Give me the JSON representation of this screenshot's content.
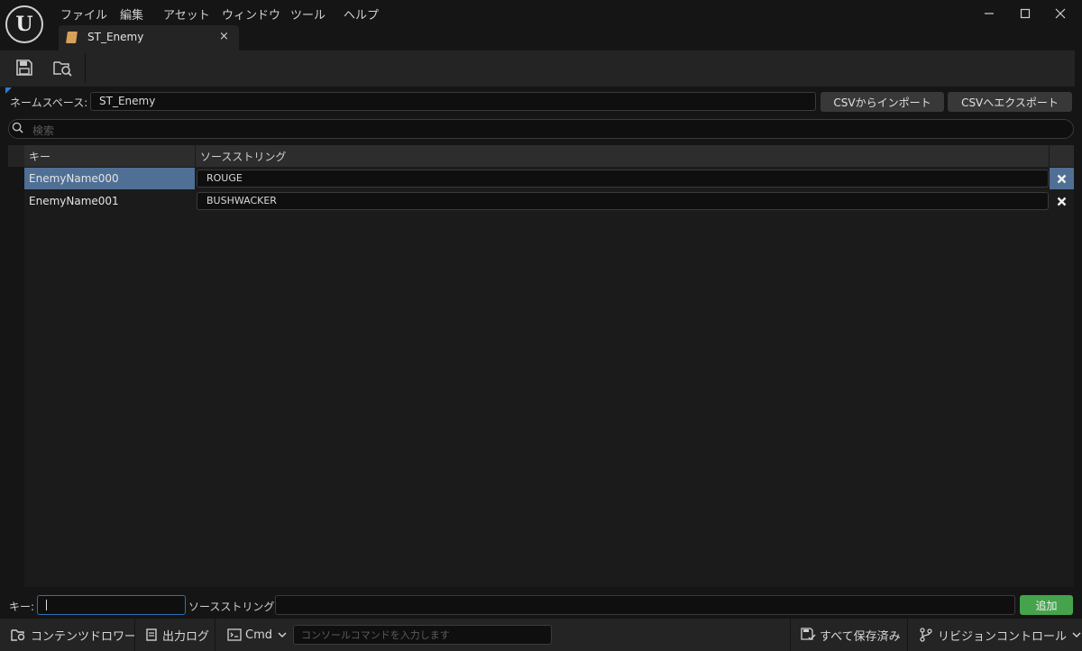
{
  "menu": {
    "items": [
      "ファイル",
      "編集",
      "アセット",
      "ウィンドウ",
      "ツール",
      "ヘルプ"
    ]
  },
  "tab": {
    "title": "ST_Enemy",
    "close": "×"
  },
  "window_controls": {
    "minimize": "—",
    "maximize": "☐",
    "close": "✕"
  },
  "toolbar": {
    "save_icon": "save-icon",
    "browse_icon": "browse-icon"
  },
  "namespace": {
    "label": "ネームスペース:",
    "value": "ST_Enemy"
  },
  "buttons": {
    "import": "CSVからインポート",
    "export": "CSVへエクスポート"
  },
  "search": {
    "placeholder": "検索"
  },
  "table": {
    "headers": {
      "key": "キー",
      "source": "ソースストリング"
    },
    "rows": [
      {
        "key": "EnemyName000",
        "value": "ROUGE",
        "selected": true
      },
      {
        "key": "EnemyName001",
        "value": "BUSHWACKER",
        "selected": false
      }
    ]
  },
  "add_bar": {
    "key_label": "キー:",
    "source_label": "ソースストリング:",
    "add_button": "追加"
  },
  "statusbar": {
    "content_drawer": "コンテンツドロワー",
    "output_log": "出力ログ",
    "cmd": "Cmd",
    "console_placeholder": "コンソールコマンドを入力します",
    "save_all": "すべて保存済み",
    "revision_control": "リビジョンコントロール"
  },
  "colors": {
    "selection": "#4f6f95",
    "accent_blue": "#2e6fb8",
    "add_green": "#44a34b",
    "asset_icon": "#d8a158"
  }
}
